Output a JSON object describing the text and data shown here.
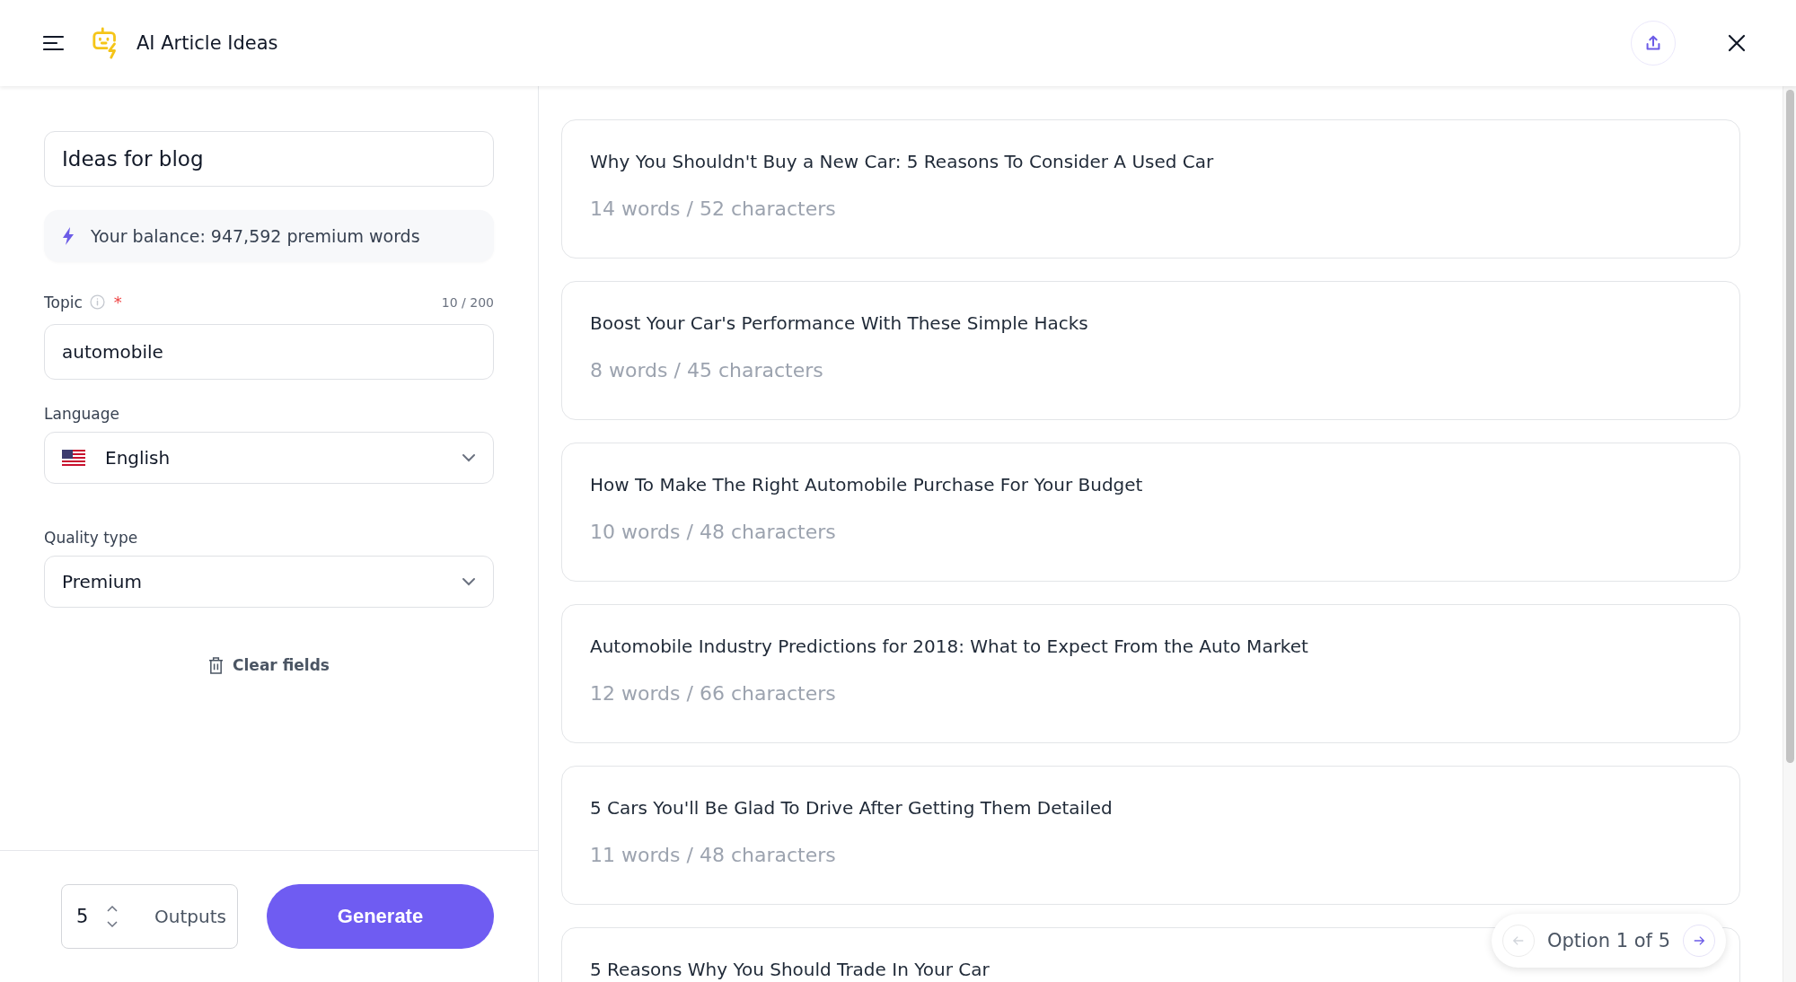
{
  "header": {
    "title": "AI Article Ideas"
  },
  "form": {
    "document_title": "Ideas for blog",
    "balance": "Your balance: 947,592 premium words",
    "topic": {
      "label": "Topic",
      "required_mark": "*",
      "counter": "10 / 200",
      "value": "automobile"
    },
    "language": {
      "label": "Language",
      "value": "English"
    },
    "quality": {
      "label": "Quality type",
      "value": "Premium"
    },
    "clear_button": "Clear fields",
    "outputs": {
      "value": "5",
      "label": "Outputs"
    },
    "generate_button": "Generate"
  },
  "results": [
    {
      "title": "Why You Shouldn't Buy a New Car: 5 Reasons To Consider A Used Car",
      "stats": "14 words / 52 characters"
    },
    {
      "title": "Boost Your Car's Performance With These Simple Hacks",
      "stats": "8 words / 45 characters"
    },
    {
      "title": "How To Make The Right Automobile Purchase For Your Budget",
      "stats": "10 words / 48 characters"
    },
    {
      "title": "Automobile Industry Predictions for 2018: What to Expect From the Auto Market",
      "stats": "12 words / 66 characters"
    },
    {
      "title": "5 Cars You'll Be Glad To Drive After Getting Them Detailed",
      "stats": "11 words / 48 characters"
    },
    {
      "title": "5 Reasons Why You Should Trade In Your Car"
    }
  ],
  "pager": {
    "label": "Option 1 of 5",
    "prev_disabled": true,
    "next_disabled": false
  }
}
